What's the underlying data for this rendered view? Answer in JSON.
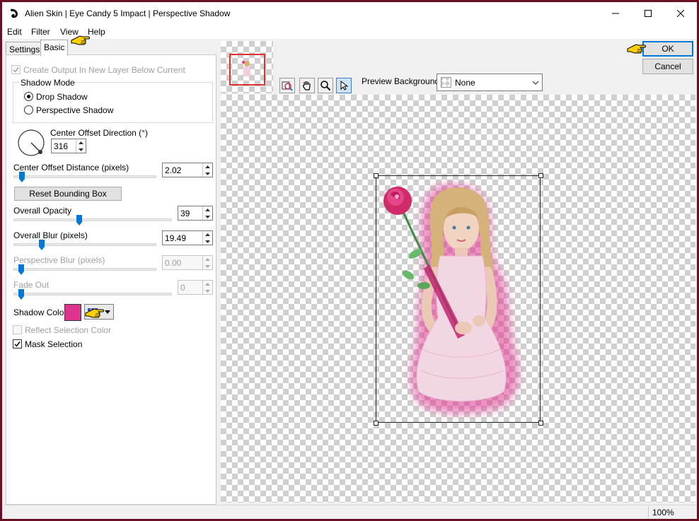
{
  "window": {
    "title": "Alien Skin | Eye Candy 5 Impact | Perspective Shadow"
  },
  "menu": [
    "Edit",
    "Filter",
    "View",
    "Help"
  ],
  "tabs": [
    "Settings",
    "Basic"
  ],
  "basic": {
    "create_output_label": "Create Output In New Layer Below Current",
    "shadow_mode_label": "Shadow Mode",
    "drop_shadow_label": "Drop Shadow",
    "perspective_shadow_label": "Perspective Shadow",
    "center_offset_direction_label": "Center Offset Direction (°)",
    "center_offset_direction_value": "316",
    "center_offset_distance_label": "Center Offset Distance (pixels)",
    "center_offset_distance_value": "2.02",
    "reset_bounding_box_label": "Reset Bounding Box",
    "overall_opacity_label": "Overall Opacity",
    "overall_opacity_value": "39",
    "overall_blur_label": "Overall Blur (pixels)",
    "overall_blur_value": "19.49",
    "perspective_blur_label": "Perspective Blur (pixels)",
    "perspective_blur_value": "0.00",
    "fade_out_label": "Fade Out",
    "fade_out_value": "0",
    "shadow_color_label": "Shadow Color",
    "shadow_color": "#e0338f",
    "reflect_selection_color_label": "Reflect Selection Color",
    "mask_selection_label": "Mask Selection"
  },
  "buttons": {
    "ok_label": "OK",
    "cancel_label": "Cancel"
  },
  "preview": {
    "background_label": "Preview Background:",
    "background_value": "None"
  },
  "status": {
    "zoom": "100%"
  },
  "colors": {
    "accent": "#0078d7",
    "frame": "#6b0f23",
    "pointer_hand": "#ffd000"
  },
  "icons": [
    "app-logo-icon",
    "minimize-icon",
    "maximize-icon",
    "close-icon",
    "pointing-hand-icon",
    "navigate-icon",
    "hand-pan-icon",
    "zoom-icon",
    "arrow-select-icon",
    "dropdown-arrow-icon"
  ]
}
